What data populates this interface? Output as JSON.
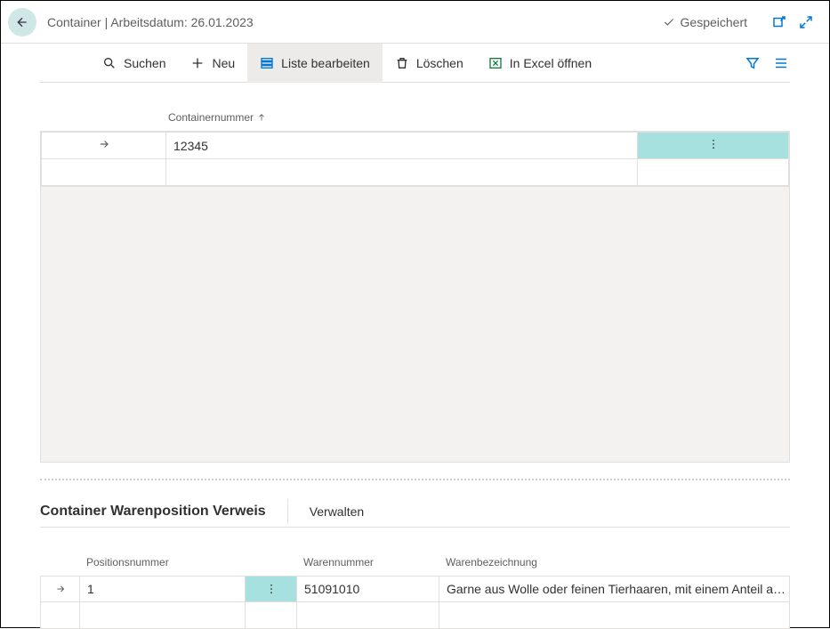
{
  "header": {
    "title": "Container | Arbeitsdatum: 26.01.2023",
    "saved_label": "Gespeichert"
  },
  "toolbar": {
    "search": "Suchen",
    "new": "Neu",
    "edit_list": "Liste bearbeiten",
    "delete": "Löschen",
    "open_excel": "In Excel öffnen"
  },
  "upper_table": {
    "column_header": "Containernummer",
    "rows": [
      {
        "value": "12345"
      }
    ]
  },
  "section": {
    "title": "Container Warenposition Verweis",
    "action": "Verwalten"
  },
  "lower_table": {
    "columns": {
      "pos": "Positionsnummer",
      "waren_nr": "Warennummer",
      "bezeichnung": "Warenbezeichnung"
    },
    "rows": [
      {
        "pos": "1",
        "waren_nr": "51091010",
        "bezeichnung": "Garne aus Wolle oder feinen Tierhaaren, mit einem Anteil a…"
      }
    ]
  }
}
